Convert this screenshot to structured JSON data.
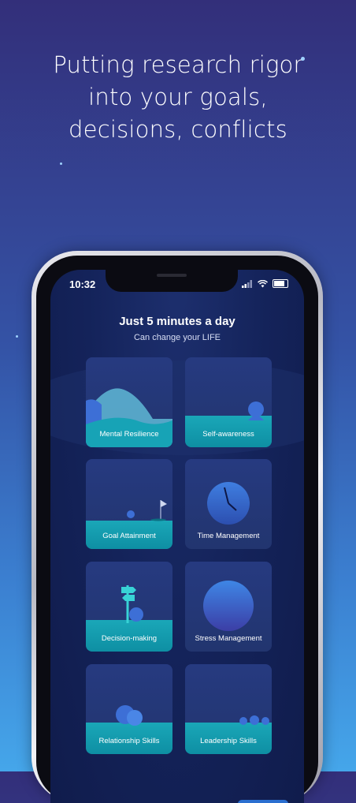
{
  "headline": {
    "line1": "Putting research rigor",
    "line2": "into your goals,",
    "line3": "decisions, conflicts"
  },
  "status_bar": {
    "time": "10:32"
  },
  "screen": {
    "title": "Just 5 minutes a day",
    "subtitle": "Can change your LIFE"
  },
  "cards": [
    {
      "label": "Mental Resilience",
      "icon": "mountain-icon"
    },
    {
      "label": "Self-awareness",
      "icon": "person-icon"
    },
    {
      "label": "Goal Attainment",
      "icon": "flag-icon"
    },
    {
      "label": "Time Management",
      "icon": "clock-icon"
    },
    {
      "label": "Decision-making",
      "icon": "signpost-icon"
    },
    {
      "label": "Stress Management",
      "icon": "sphere-icon"
    },
    {
      "label": "Relationship Skills",
      "icon": "pair-icon"
    },
    {
      "label": "Leadership Skills",
      "icon": "group-icon"
    }
  ],
  "colors": {
    "background_top": "#332f7a",
    "background_bottom": "#45a6ea",
    "card": "#263a80",
    "card_ground": "#1aa7b8",
    "accent_ball": "#3d6fd6"
  }
}
